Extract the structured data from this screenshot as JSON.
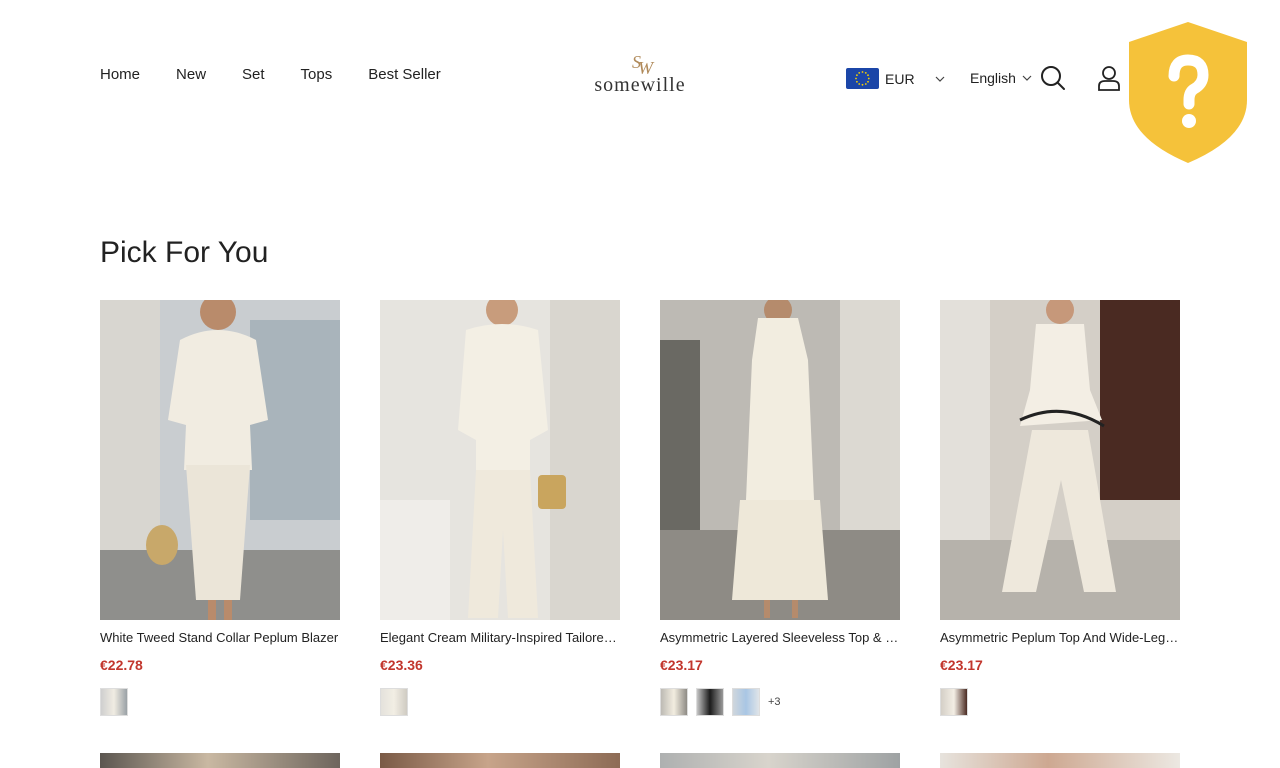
{
  "header": {
    "nav": [
      "Home",
      "New",
      "Set",
      "Tops",
      "Best Seller"
    ],
    "logo_monogram": "SW",
    "logo_text": "somewille",
    "currency": "EUR",
    "language": "English"
  },
  "section": {
    "title": "Pick For You"
  },
  "products": [
    {
      "name": "White Tweed Stand Collar Peplum Blazer",
      "price": "€22.78",
      "more": ""
    },
    {
      "name": "Elegant Cream Military-Inspired Tailored Suit",
      "price": "€23.36",
      "more": ""
    },
    {
      "name": "Asymmetric Layered Sleeveless Top & Pants",
      "price": "€23.17",
      "more": "+3"
    },
    {
      "name": "Asymmetric Peplum Top And Wide-Leg Pants",
      "price": "€23.17",
      "more": ""
    }
  ],
  "colors": {
    "price": "#c2362d",
    "shield": "#f5c23a",
    "flag": "#1b46a8"
  }
}
